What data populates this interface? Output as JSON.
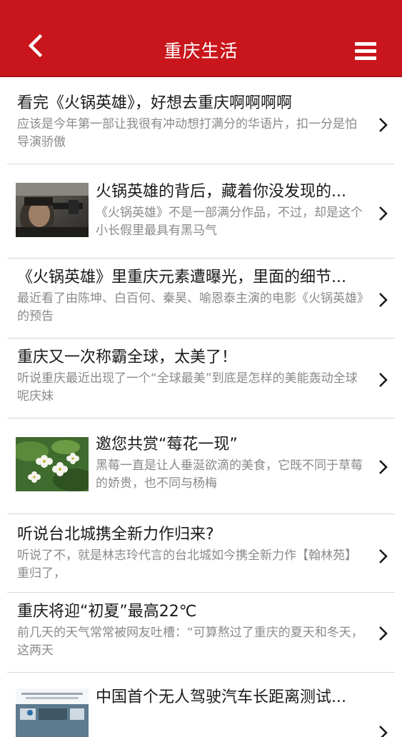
{
  "header": {
    "title": "重庆生活",
    "back_icon": "chevron-left-icon",
    "menu_icon": "hamburger-menu-icon",
    "background_color": "#c9161c"
  },
  "articles": [
    {
      "title": "看完《火锅英雄》，好想去重庆啊啊啊啊",
      "summary": "应该是今年第一部让我很有冲动想打满分的华语片，扣一分是怕导演骄傲",
      "has_thumbnail": false
    },
    {
      "title": "火锅英雄的背后，藏着你没发现的...",
      "summary": "《火锅英雄》不是一部满分作品，不过，却是这个小长假里最具有黑马气",
      "has_thumbnail": true,
      "thumbnail": "movie-still-image"
    },
    {
      "title": "《火锅英雄》里重庆元素遭曝光，里面的细节...",
      "summary": "最近看了由陈坤、白百何、秦昊、喻恩泰主演的电影《火锅英雄》的预告",
      "has_thumbnail": false
    },
    {
      "title": "重庆又一次称霸全球，太美了！",
      "summary": "听说重庆最近出现了一个“全球最美”到底是怎样的美能轰动全球呢庆妹",
      "has_thumbnail": false
    },
    {
      "title": "邀您共赏“莓花一现”",
      "summary": "黑莓一直是让人垂涎欲滴的美食，它既不同于草莓的娇贵，也不同与杨梅",
      "has_thumbnail": true,
      "thumbnail": "blackberry-flower-image"
    },
    {
      "title": "听说台北城携全新力作归来?",
      "summary": "听说了不，就是林志玲代言的台北城如今携全新力作【翰林苑】重归了，",
      "has_thumbnail": false
    },
    {
      "title": "重庆将迎“初夏”最高22℃",
      "summary": "前几天的天气常常被网友吐槽：“可算熬过了重庆的夏天和冬天，这两天",
      "has_thumbnail": false
    },
    {
      "title": "中国首个无人驾驶汽车长距离测试...",
      "summary": "",
      "has_thumbnail": true,
      "thumbnail": "driverless-car-test-image"
    }
  ]
}
